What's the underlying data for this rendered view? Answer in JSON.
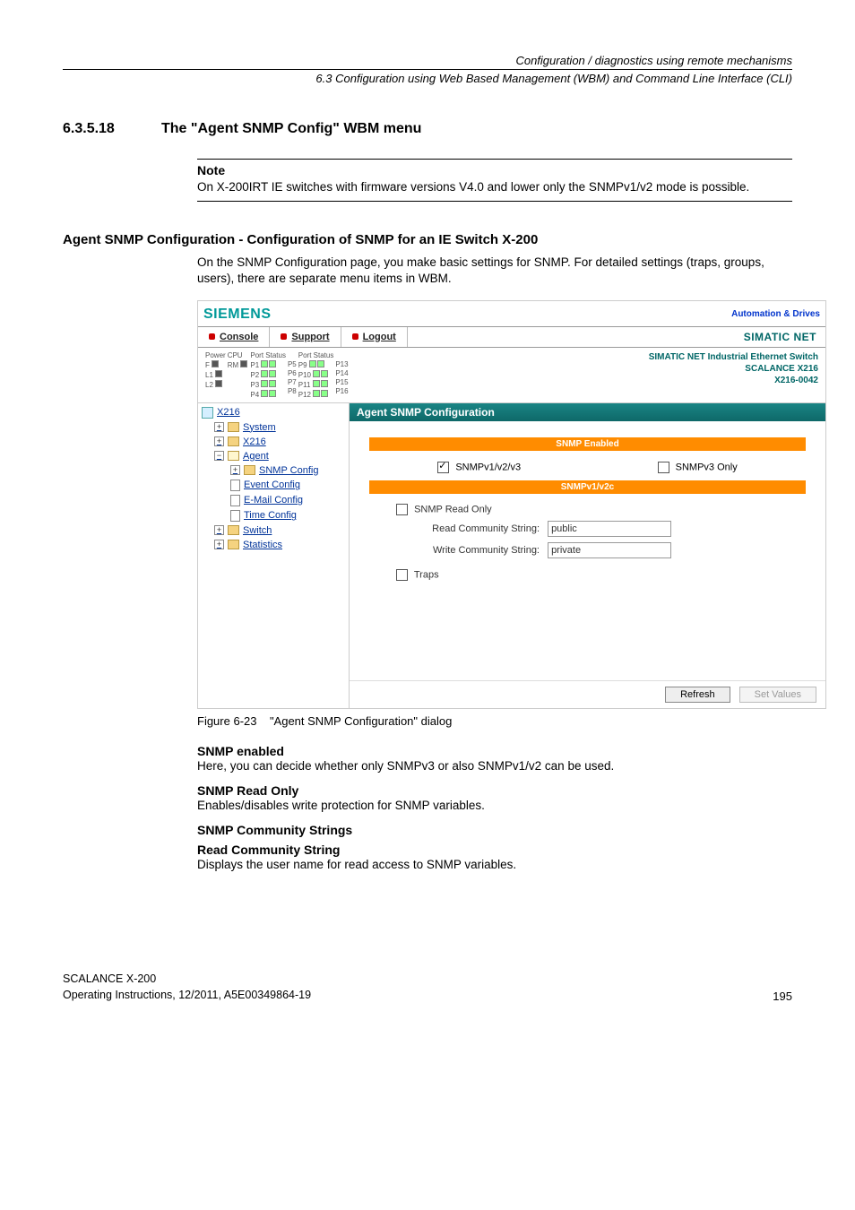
{
  "running_head": "Configuration / diagnostics using remote mechanisms",
  "running_sub": "6.3 Configuration using Web Based Management (WBM) and Command Line Interface (CLI)",
  "section": {
    "number": "6.3.5.18",
    "title": "The \"Agent SNMP Config\" WBM menu"
  },
  "note": {
    "label": "Note",
    "body": "On X-200IRT IE switches with firmware versions V4.0 and lower only the SNMPv1/v2 mode is possible."
  },
  "h2": "Agent SNMP Configuration - Configuration of SNMP for an IE Switch X-200",
  "intro": "On the SNMP Configuration page, you make basic settings for SNMP. For detailed settings (traps, groups, users), there are separate menu items in WBM.",
  "figure": {
    "siemens": "SIEMENS",
    "ad": "Automation & Drives",
    "tabs": {
      "console": "Console",
      "support": "Support",
      "logout": "Logout"
    },
    "simatic_net": "SIMATIC NET",
    "portbar": {
      "power": "Power",
      "cpu": "CPU",
      "port_status_a": "Port Status",
      "port_status_b": "Port Status",
      "left_labels": [
        "F",
        "L1",
        "L2"
      ],
      "rm": "RM",
      "ports_a": [
        "P1",
        "P2",
        "P3",
        "P4"
      ],
      "ports_b": [
        "P5",
        "P6",
        "P7",
        "P8"
      ],
      "ports_c": [
        "P9",
        "P10",
        "P11",
        "P12"
      ],
      "ports_d": [
        "P13",
        "P14",
        "P15",
        "P16"
      ]
    },
    "device_id": {
      "l1": "SIMATIC NET Industrial Ethernet Switch",
      "l2": "SCALANCE X216",
      "l3": "X216-0042"
    },
    "nav": {
      "root": "X216",
      "system": "System",
      "x216": "X216",
      "agent": "Agent",
      "snmp_config": "SNMP Config",
      "event_config": "Event Config",
      "email_config": "E-Mail Config",
      "time_config": "Time Config",
      "switch": "Switch",
      "statistics": "Statistics"
    },
    "main": {
      "title": "Agent SNMP Configuration",
      "band_enabled": "SNMP Enabled",
      "snmp_v123": "SNMPv1/v2/v3",
      "snmp_v3only": "SNMPv3 Only",
      "band_v12c": "SNMPv1/v2c",
      "read_only": "SNMP Read Only",
      "read_comm_label": "Read Community String:",
      "read_comm_value": "public",
      "write_comm_label": "Write Community String:",
      "write_comm_value": "private",
      "traps": "Traps",
      "refresh": "Refresh",
      "set_values": "Set Values"
    },
    "caption_label": "Figure 6-23",
    "caption_text": "\"Agent SNMP Configuration\" dialog"
  },
  "body": {
    "snmp_enabled_h": "SNMP enabled",
    "snmp_enabled_t": "Here, you can decide whether only SNMPv3 or also SNMPv1/v2 can be used.",
    "snmp_ro_h": "SNMP Read Only",
    "snmp_ro_t": "Enables/disables write protection for SNMP variables.",
    "comm_strings_h": "SNMP Community Strings",
    "read_comm_h": "Read Community String",
    "read_comm_t": "Displays the user name for read access to SNMP variables."
  },
  "footer": {
    "l1": "SCALANCE X-200",
    "l2": "Operating Instructions, 12/2011, A5E00349864-19",
    "page": "195"
  }
}
